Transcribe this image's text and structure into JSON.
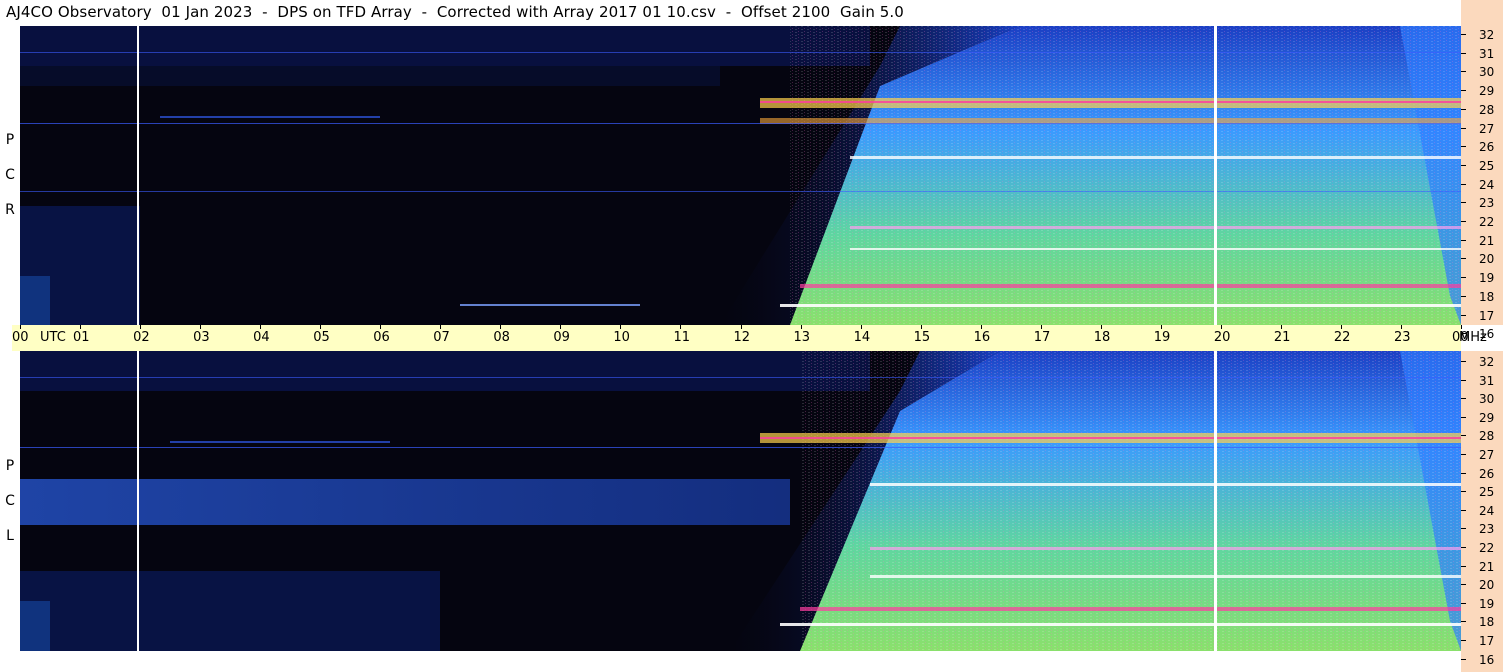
{
  "title": "AJ4CO Observatory  01 Jan 2023  -  DPS on TFD Array  -  Corrected with Array 2017 01 10.csv  -  Offset 2100  Gain 5.0",
  "top_panel": {
    "polarization": [
      "R",
      "C",
      "P"
    ]
  },
  "bottom_panel": {
    "polarization": [
      "L",
      "C",
      "P"
    ]
  },
  "freq_ticks": [
    "32",
    "31",
    "30",
    "29",
    "28",
    "27",
    "26",
    "25",
    "24",
    "23",
    "22",
    "21",
    "20",
    "19",
    "18",
    "17",
    "16"
  ],
  "time_axis": {
    "hours": [
      "00",
      "01",
      "02",
      "03",
      "04",
      "05",
      "06",
      "07",
      "08",
      "09",
      "10",
      "11",
      "12",
      "13",
      "14",
      "15",
      "16",
      "17",
      "18",
      "19",
      "20",
      "21",
      "22",
      "23",
      "00"
    ],
    "utc_label": "UTC",
    "unit_label": "MHz"
  },
  "colors": {
    "background_dark": "#050510",
    "low_intensity": "#0a2a8a",
    "mid_intensity": "#2f8cff",
    "high_intensity": "#7fe07a",
    "hot_spots": "#ff3aa0",
    "freq_axis_bg": "#fbd9bd",
    "time_axis_bg": "#ffffc4"
  }
}
